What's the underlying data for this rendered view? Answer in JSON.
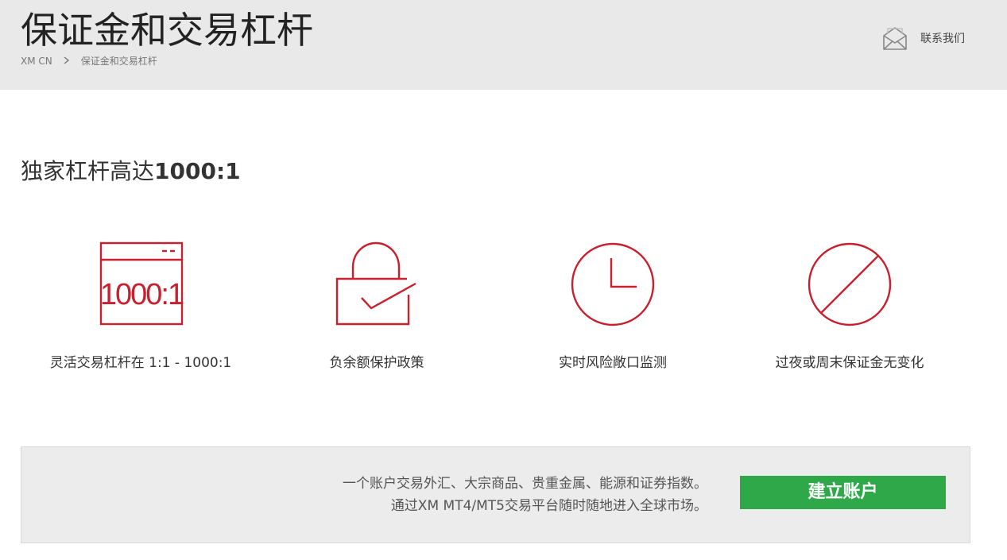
{
  "header": {
    "title": "保证金和交易杠杆",
    "breadcrumb": {
      "home": "XM CN",
      "current": "保证金和交易杠杆"
    },
    "contact_label": "联系我们",
    "contact_icon": "envelope-icon"
  },
  "section": {
    "title_prefix": "独家杠杆高达",
    "title_strong": "1000:1"
  },
  "features": [
    {
      "icon": "leverage-window-icon",
      "icon_text": "1000:1",
      "label": "灵活交易杠杆在 1:1 - 1000:1"
    },
    {
      "icon": "lock-check-icon",
      "label": "负余额保护政策"
    },
    {
      "icon": "clock-icon",
      "label": "实时风险敞口监测"
    },
    {
      "icon": "no-sign-icon",
      "label": "过夜或周末保证金无变化"
    }
  ],
  "cta": {
    "line1": "一个账户交易外汇、大宗商品、贵重金属、能源和证券指数。",
    "line2": "通过XM MT4/MT5交易平台随时随地进入全球市场。",
    "button_label": "建立账户"
  },
  "colors": {
    "accent_red": "#c8202e",
    "button_green": "#2fa84a",
    "header_bg": "#e9e9e9"
  }
}
